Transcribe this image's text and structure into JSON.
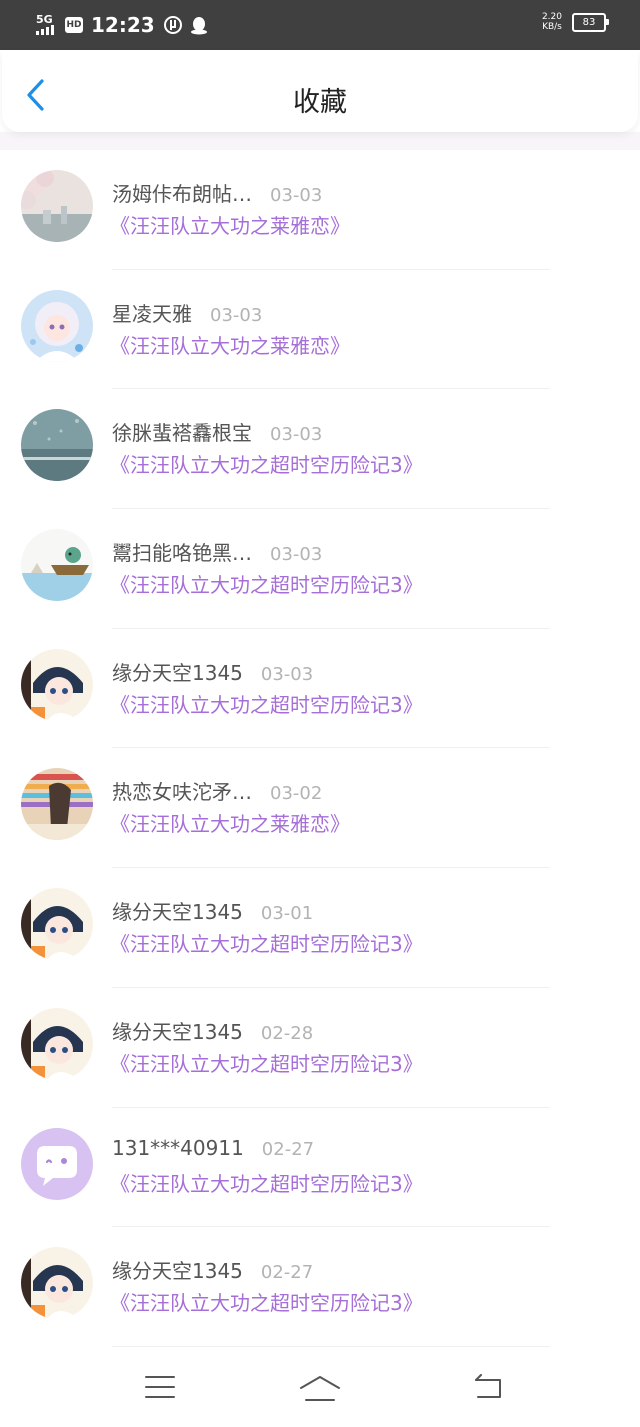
{
  "status": {
    "network": "5G",
    "hd": "HD",
    "time": "12:23",
    "speed_value": "2.20",
    "speed_unit": "KB/s",
    "battery": "83"
  },
  "header": {
    "title": "收藏"
  },
  "colors": {
    "accent_purple": "#a66ed8",
    "back_blue": "#1e8fe6",
    "status_bg": "#404040"
  },
  "items": [
    {
      "name": "汤姆佧布朗帖…",
      "date": "03-03",
      "book": "《汪汪队立大功之莱雅恋》",
      "avatar": "cherry-blossom-city"
    },
    {
      "name": "星凌天雅",
      "date": "03-03",
      "book": "《汪汪队立大功之莱雅恋》",
      "avatar": "anime-girl-white-hair"
    },
    {
      "name": "徐脒蜚褡馫根宝",
      "date": "03-03",
      "book": "《汪汪队立大功之超时空历险记3》",
      "avatar": "rainy-sea"
    },
    {
      "name": "鬻扫能咯铯黑…",
      "date": "03-03",
      "book": "《汪汪队立大功之超时空历险记3》",
      "avatar": "boat-on-water"
    },
    {
      "name": "缘分天空1345",
      "date": "03-03",
      "book": "《汪汪队立大功之超时空历险记3》",
      "avatar": "anime-boy-blue-hair"
    },
    {
      "name": "热恋女呋沱矛…",
      "date": "03-02",
      "book": "《汪汪队立大功之莱雅恋》",
      "avatar": "colorful-stripes-photo"
    },
    {
      "name": "缘分天空1345",
      "date": "03-01",
      "book": "《汪汪队立大功之超时空历险记3》",
      "avatar": "anime-boy-blue-hair"
    },
    {
      "name": "缘分天空1345",
      "date": "02-28",
      "book": "《汪汪队立大功之超时空历险记3》",
      "avatar": "anime-boy-blue-hair"
    },
    {
      "name": "131***40911",
      "date": "02-27",
      "book": "《汪汪队立大功之超时空历险记3》",
      "avatar": "default-chat-bubble"
    },
    {
      "name": "缘分天空1345",
      "date": "02-27",
      "book": "《汪汪队立大功之超时空历险记3》",
      "avatar": "anime-boy-blue-hair"
    }
  ],
  "navbar": {
    "menu": "menu-icon",
    "home": "home-icon",
    "back": "back-icon"
  }
}
